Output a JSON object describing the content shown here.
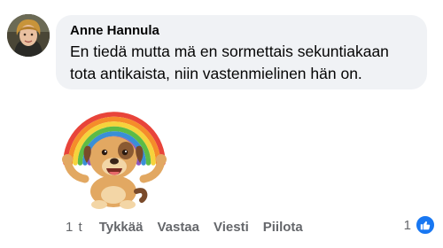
{
  "comment": {
    "author": "Anne Hannula",
    "text": "En tiedä mutta mä en sormettais sekuntiakaan tota antikaista, niin vastenmielinen hän on.",
    "sticker": "rainbow-puppy-sticker"
  },
  "actions": {
    "time": "1 t",
    "like": "Tykkää",
    "reply": "Vastaa",
    "message": "Viesti",
    "hide": "Piilota"
  },
  "reactions": {
    "count": "1",
    "icon": "like-icon",
    "color": "#1877f2"
  },
  "colors": {
    "bubble": "#f0f2f5",
    "meta_text": "#65676b",
    "text": "#050505"
  }
}
